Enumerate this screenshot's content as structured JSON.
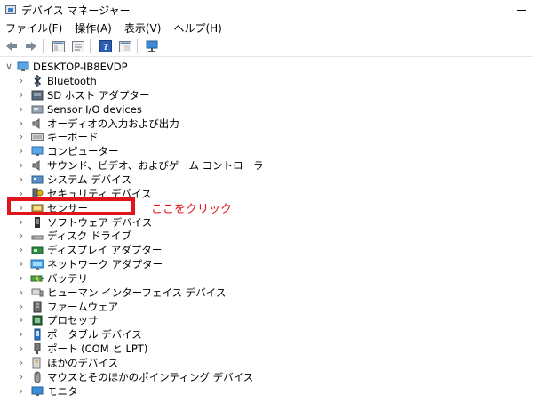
{
  "window": {
    "title": "デバイス マネージャー"
  },
  "menu": [
    "ファイル(F)",
    "操作(A)",
    "表示(V)",
    "ヘルプ(H)"
  ],
  "tree": {
    "root": "DESKTOP-IB8EVDP",
    "items": [
      {
        "label": "Bluetooth",
        "icon": "bluetooth-icon"
      },
      {
        "label": "SD ホスト アダプター",
        "icon": "sd-host-icon"
      },
      {
        "label": "Sensor I/O devices",
        "icon": "sensor-io-icon"
      },
      {
        "label": "オーディオの入力および出力",
        "icon": "speaker-icon"
      },
      {
        "label": "キーボード",
        "icon": "keyboard-icon"
      },
      {
        "label": "コンピューター",
        "icon": "computer-icon"
      },
      {
        "label": "サウンド、ビデオ、およびゲーム コントローラー",
        "icon": "speaker-icon"
      },
      {
        "label": "システム デバイス",
        "icon": "system-device-icon"
      },
      {
        "label": "セキュリティ デバイス",
        "icon": "security-device-icon"
      },
      {
        "label": "センサー",
        "icon": "sensor-icon"
      },
      {
        "label": "ソフトウェア デバイス",
        "icon": "software-device-icon"
      },
      {
        "label": "ディスク ドライブ",
        "icon": "disk-drive-icon"
      },
      {
        "label": "ディスプレイ アダプター",
        "icon": "display-adapter-icon"
      },
      {
        "label": "ネットワーク アダプター",
        "icon": "network-adapter-icon"
      },
      {
        "label": "バッテリ",
        "icon": "battery-icon"
      },
      {
        "label": "ヒューマン インターフェイス デバイス",
        "icon": "hid-icon"
      },
      {
        "label": "ファームウェア",
        "icon": "firmware-icon"
      },
      {
        "label": "プロセッサ",
        "icon": "processor-icon"
      },
      {
        "label": "ポータブル デバイス",
        "icon": "portable-device-icon"
      },
      {
        "label": "ポート (COM と LPT)",
        "icon": "port-icon"
      },
      {
        "label": "ほかのデバイス",
        "icon": "other-device-icon"
      },
      {
        "label": "マウスとそのほかのポインティング デバイス",
        "icon": "mouse-icon"
      },
      {
        "label": "モニター",
        "icon": "monitor-icon"
      }
    ]
  },
  "annotation": {
    "text": "ここをクリック",
    "color": "#e0141a"
  }
}
